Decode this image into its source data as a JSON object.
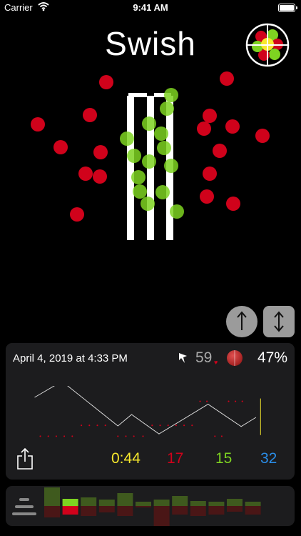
{
  "status_bar": {
    "carrier": "Carrier",
    "time": "9:41 AM"
  },
  "app_title": "Swish",
  "delivery_plot": {
    "red_hits": [
      [
        149,
        115
      ],
      [
        318,
        110
      ],
      [
        126,
        161
      ],
      [
        53,
        174
      ],
      [
        294,
        162
      ],
      [
        286,
        180
      ],
      [
        326,
        177
      ],
      [
        368,
        190
      ],
      [
        85,
        206
      ],
      [
        141,
        213
      ],
      [
        308,
        211
      ],
      [
        120,
        243
      ],
      [
        140,
        247
      ],
      [
        294,
        243
      ],
      [
        290,
        275
      ],
      [
        327,
        285
      ],
      [
        108,
        300
      ]
    ],
    "green_hits": [
      [
        240,
        133
      ],
      [
        234,
        152
      ],
      [
        209,
        173
      ],
      [
        226,
        187
      ],
      [
        178,
        194
      ],
      [
        230,
        207
      ],
      [
        188,
        218
      ],
      [
        209,
        226
      ],
      [
        240,
        232
      ],
      [
        194,
        248
      ],
      [
        196,
        268
      ],
      [
        228,
        269
      ],
      [
        207,
        285
      ],
      [
        248,
        296
      ]
    ]
  },
  "session": {
    "date": "April 4, 2019 at 4:33 PM",
    "pace": "59",
    "accuracy": "47%",
    "timer": "0:44",
    "misses": "17",
    "hits": "15",
    "total": "32"
  },
  "trace": {
    "line": [
      [
        0,
        60
      ],
      [
        48,
        32
      ],
      [
        146,
        110
      ],
      [
        170,
        90
      ],
      [
        218,
        124
      ],
      [
        304,
        72
      ],
      [
        362,
        111
      ],
      [
        388,
        95
      ]
    ],
    "red_dots": [
      [
        10,
        128
      ],
      [
        24,
        128
      ],
      [
        38,
        128
      ],
      [
        52,
        128
      ],
      [
        66,
        128
      ],
      [
        82,
        109
      ],
      [
        96,
        109
      ],
      [
        110,
        109
      ],
      [
        124,
        109
      ],
      [
        146,
        128
      ],
      [
        160,
        128
      ],
      [
        174,
        128
      ],
      [
        190,
        128
      ],
      [
        206,
        109
      ],
      [
        220,
        109
      ],
      [
        234,
        109
      ],
      [
        248,
        109
      ],
      [
        262,
        109
      ],
      [
        276,
        109
      ],
      [
        290,
        67
      ],
      [
        302,
        67
      ],
      [
        316,
        128
      ],
      [
        328,
        128
      ],
      [
        340,
        67
      ],
      [
        352,
        67
      ],
      [
        364,
        67
      ]
    ]
  },
  "history_bars": [
    {
      "good": 26,
      "bad": 16,
      "highlight": false
    },
    {
      "good": 10,
      "bad": 12,
      "highlight": true
    },
    {
      "good": 12,
      "bad": 14,
      "highlight": false
    },
    {
      "good": 9,
      "bad": 9,
      "highlight": false
    },
    {
      "good": 18,
      "bad": 14,
      "highlight": false
    },
    {
      "good": 6,
      "bad": 2,
      "highlight": false
    },
    {
      "good": 9,
      "bad": 28,
      "highlight": false
    },
    {
      "good": 14,
      "bad": 12,
      "highlight": false
    },
    {
      "good": 7,
      "bad": 14,
      "highlight": false
    },
    {
      "good": 6,
      "bad": 12,
      "highlight": false
    },
    {
      "good": 10,
      "bad": 8,
      "highlight": false
    },
    {
      "good": 6,
      "bad": 12,
      "highlight": false
    }
  ],
  "colors": {
    "hit": "#7ed321",
    "miss": "#d0021b",
    "timer": "#f7e82c",
    "total": "#2a8ce6",
    "bar_good": "#3f5a1e",
    "bar_bad": "#4a1616",
    "bar_good_highlight": "#7ed321",
    "bar_bad_highlight": "#d0021b"
  },
  "icons": [
    "wifi-icon",
    "battery-icon",
    "app-logo-icon",
    "up-arrow-icon",
    "up-down-arrow-icon",
    "bowler-pin-icon",
    "heart-icon",
    "cricket-ball-icon",
    "share-icon",
    "menu-lines-icon"
  ]
}
